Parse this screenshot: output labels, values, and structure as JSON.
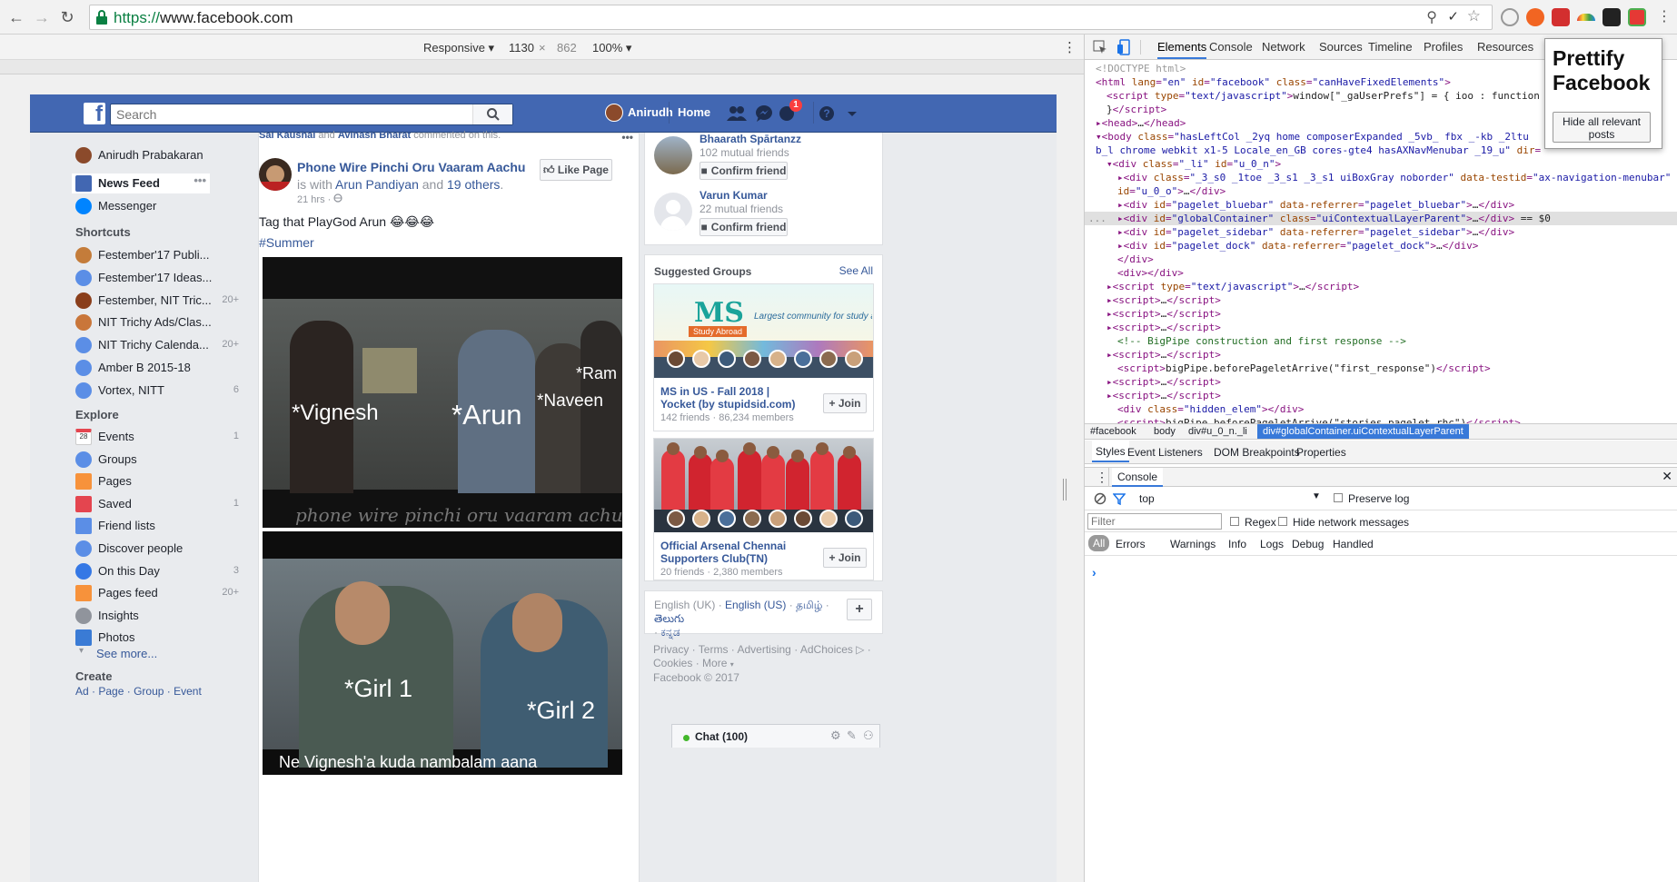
{
  "browser": {
    "url_protocol": "https://",
    "url_host": "www.facebook.com"
  },
  "devicebar": {
    "mode": "Responsive",
    "width": "1130",
    "times": "×",
    "height": "862",
    "zoom": "100%"
  },
  "header": {
    "search_placeholder": "Search",
    "user_name": "Anirudh",
    "home_label": "Home",
    "notification_count": "1"
  },
  "leftnav": {
    "profile_name": "Anirudh Prabakaran",
    "news_feed": "News Feed",
    "messenger": "Messenger",
    "shortcuts_title": "Shortcuts",
    "shortcuts": [
      {
        "label": "Festember'17 Publi...",
        "count": ""
      },
      {
        "label": "Festember'17 Ideas...",
        "count": ""
      },
      {
        "label": "Festember, NIT Tric...",
        "count": "20+"
      },
      {
        "label": "NIT Trichy Ads/Clas...",
        "count": ""
      },
      {
        "label": "NIT Trichy Calenda...",
        "count": "20+"
      },
      {
        "label": "Amber B 2015-18",
        "count": ""
      },
      {
        "label": "Vortex, NITT",
        "count": "6"
      }
    ],
    "explore_title": "Explore",
    "explore": [
      {
        "label": "Events",
        "count": "1"
      },
      {
        "label": "Groups",
        "count": ""
      },
      {
        "label": "Pages",
        "count": ""
      },
      {
        "label": "Saved",
        "count": "1"
      },
      {
        "label": "Friend lists",
        "count": ""
      },
      {
        "label": "Discover people",
        "count": ""
      },
      {
        "label": "On this Day",
        "count": "3"
      },
      {
        "label": "Pages feed",
        "count": "20+"
      },
      {
        "label": "Insights",
        "count": ""
      },
      {
        "label": "Photos",
        "count": ""
      }
    ],
    "see_more": "See more...",
    "create_title": "Create",
    "create_links": [
      "Ad",
      "Page",
      "Group",
      "Event"
    ],
    "events_date": "28"
  },
  "post": {
    "top_name1": "Sai Kaushal",
    "top_and": "and",
    "top_name2": "Avinash Bharat",
    "top_action": "commented on this.",
    "page_name": "Phone Wire Pinchi Oru Vaaram Aachu",
    "is_with": "is with",
    "with_name": "Arun Pandiyan",
    "and": "and",
    "others": "19 others",
    "time": "21 hrs",
    "like_page": "Like Page",
    "text": "Tag that PlayGod Arun 😂😂😂",
    "hashtag": "#Summer",
    "meme_top": {
      "labels": [
        "*Vignesh",
        "*Arun",
        "*Naveen",
        "*Ram"
      ],
      "caption": "phone wire pinchi oru vaaram achu"
    },
    "meme_bottom": {
      "labels": [
        "*Girl 1",
        "*Girl 2"
      ],
      "caption": "Ne Vignesh'a kuda nambalam aana"
    }
  },
  "people": [
    {
      "name": "Bhaarath Spārtanzz",
      "mutual": "102 mutual friends",
      "button": "Confirm friend"
    },
    {
      "name": "Varun Kumar",
      "mutual": "22 mutual friends",
      "button": "Confirm friend"
    }
  ],
  "groups": {
    "title": "Suggested Groups",
    "see_all": "See All",
    "items": [
      {
        "name": "MS in US - Fall 2018 | Yocket (by stupidsid.com)",
        "meta": "142 friends · 86,234 members",
        "join": "Join",
        "banner_title": "MS",
        "banner_sub": "Study Abroad",
        "banner_tag": "Largest community for study abroad aspirants"
      },
      {
        "name": "Official Arsenal Chennai Supporters Club(TN)",
        "meta": "20 friends · 2,380 members",
        "join": "Join"
      }
    ]
  },
  "languages": {
    "current": "English (UK)",
    "sep": "·",
    "alt1": "English (US)",
    "alt2": "தமிழ்",
    "alt3": "తెలుగు",
    "alt4": "ಕನ್ನಡ",
    "add": "+"
  },
  "footer": {
    "links": [
      "Privacy",
      "Terms",
      "Advertising",
      "AdChoices",
      "Cookies",
      "More"
    ],
    "copyright": "Facebook © 2017"
  },
  "chat": {
    "label": "Chat (100)"
  },
  "devtools": {
    "tabs": [
      "Elements",
      "Console",
      "Network",
      "Sources",
      "Timeline",
      "Profiles",
      "Resources"
    ],
    "crumbs": [
      "#facebook",
      "body",
      "div#u_0_n._li",
      "div#globalContainer.uiContextualLayerParent"
    ],
    "style_tabs": [
      "Styles",
      "Event Listeners",
      "DOM Breakpoints",
      "Properties"
    ],
    "console_tab": "Console",
    "context": "top",
    "preserve_log": "Preserve log",
    "filter_placeholder": "Filter",
    "regex": "Regex",
    "hide_network": "Hide network messages",
    "levels": [
      "All",
      "Errors",
      "Warnings",
      "Info",
      "Logs",
      "Debug",
      "Handled"
    ],
    "prompt": "›",
    "selected_marker": "== $0"
  },
  "prettify": {
    "title": "Prettify Facebook",
    "button": "Hide all relevant posts"
  },
  "colors": {
    "fb_blue": "#4267b2",
    "link": "#365899",
    "dt_select": "#3879d9"
  }
}
